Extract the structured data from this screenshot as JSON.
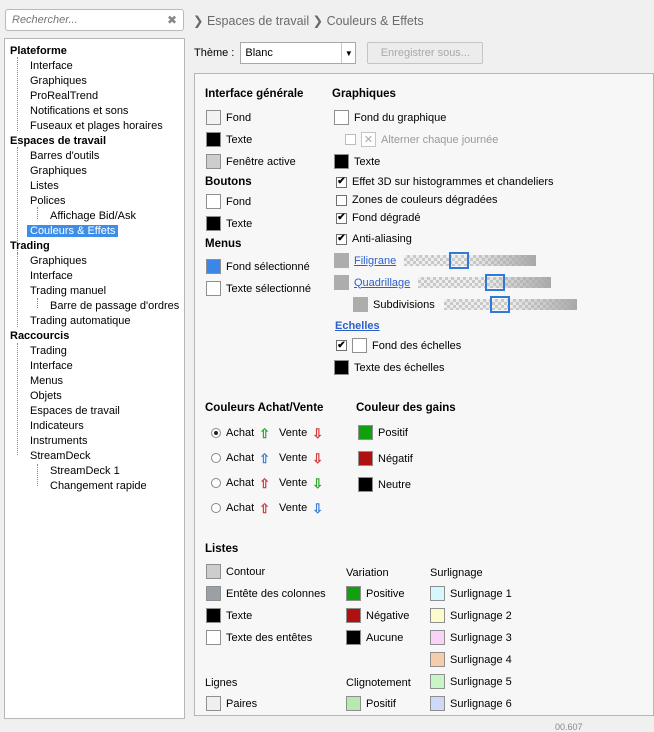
{
  "search": {
    "placeholder": "Rechercher..."
  },
  "breadcrumb": {
    "a": "Espaces de travail",
    "b": "Couleurs & Effets"
  },
  "tree": {
    "plateforme": "Plateforme",
    "p1": "Interface",
    "p2": "Graphiques",
    "p3": "ProRealTrend",
    "p4": "Notifications et sons",
    "p5": "Fuseaux et plages horaires",
    "espaces": "Espaces de travail",
    "e1": "Barres d'outils",
    "e2": "Graphiques",
    "e3": "Listes",
    "e4": "Polices",
    "e4a": "Affichage Bid/Ask",
    "e5": "Couleurs & Effets",
    "trading": "Trading",
    "t1": "Graphiques",
    "t2": "Interface",
    "t3": "Trading manuel",
    "t3a": "Barre de passage d'ordres",
    "t4": "Trading automatique",
    "raccourcis": "Raccourcis",
    "r1": "Trading",
    "r2": "Interface",
    "r3": "Menus",
    "r4": "Objets",
    "r5": "Espaces de travail",
    "r6": "Indicateurs",
    "r7": "Instruments",
    "r8": "StreamDeck",
    "r8a": "StreamDeck 1",
    "r8b": "Changement rapide"
  },
  "theme": {
    "label": "Thème :",
    "value": "Blanc",
    "save": "Enregistrer sous..."
  },
  "interface_generale": {
    "title": "Interface générale",
    "fond": "Fond",
    "texte": "Texte",
    "fenetre": "Fenêtre active"
  },
  "boutons": {
    "title": "Boutons",
    "fond": "Fond",
    "texte": "Texte"
  },
  "menus": {
    "title": "Menus",
    "fond_sel": "Fond sélectionné",
    "texte_sel": "Texte sélectionné"
  },
  "graphiques": {
    "title": "Graphiques",
    "fond": "Fond du graphique",
    "alterner": "Alterner chaque journée",
    "texte": "Texte",
    "effet3d": "Effet 3D sur histogrammes et chandeliers",
    "zones": "Zones de couleurs dégradées",
    "fond_degrade": "Fond dégradé",
    "antialias": "Anti-aliasing",
    "filigrane": "Filigrane",
    "quadrillage": "Quadrillage",
    "subdivisions": "Subdivisions",
    "echelles": "Echelles",
    "fond_echelles": "Fond des échelles",
    "texte_echelles": "Texte des échelles",
    "effet3d_checked": true,
    "zones_checked": false,
    "fond_degrade_checked": true,
    "antialias_checked": true,
    "fond_echelles_checked": true
  },
  "achat_vente": {
    "title": "Couleurs Achat/Vente",
    "achat": "Achat",
    "vente": "Vente",
    "selected_index": 0
  },
  "gains": {
    "title": "Couleur des gains",
    "positif": "Positif",
    "negatif": "Négatif",
    "neutre": "Neutre"
  },
  "listes": {
    "title": "Listes",
    "contour": "Contour",
    "entete_col": "Entête des colonnes",
    "texte": "Texte",
    "texte_entetes": "Texte des entêtes",
    "variation": "Variation",
    "positive": "Positive",
    "negative": "Négative",
    "aucune": "Aucune",
    "surlignage": "Surlignage",
    "s1": "Surlignage 1",
    "s2": "Surlignage 2",
    "s3": "Surlignage 3",
    "s4": "Surlignage 4",
    "s5": "Surlignage 5",
    "s6": "Surlignage 6",
    "lignes": "Lignes",
    "paires": "Paires",
    "clignotement": "Clignotement",
    "c_positif": "Positif"
  },
  "colors": {
    "accent": "#3d8ee8",
    "green": "#10a010",
    "red": "#b01010",
    "black": "#000000",
    "light_gray": "#cdcdcd",
    "mid_gray": "#9aa0a6",
    "white": "#ffffff",
    "blue_sel": "#3b87e8",
    "s1": "#d6f7fb",
    "s2": "#fcfbcd",
    "s3": "#f9d3f6",
    "s4": "#f5cda8",
    "s5": "#c8f4c8",
    "s6": "#cfd8f7",
    "clign_pos": "#b6e8b0"
  },
  "footer": {
    "fragment": "00.607"
  }
}
